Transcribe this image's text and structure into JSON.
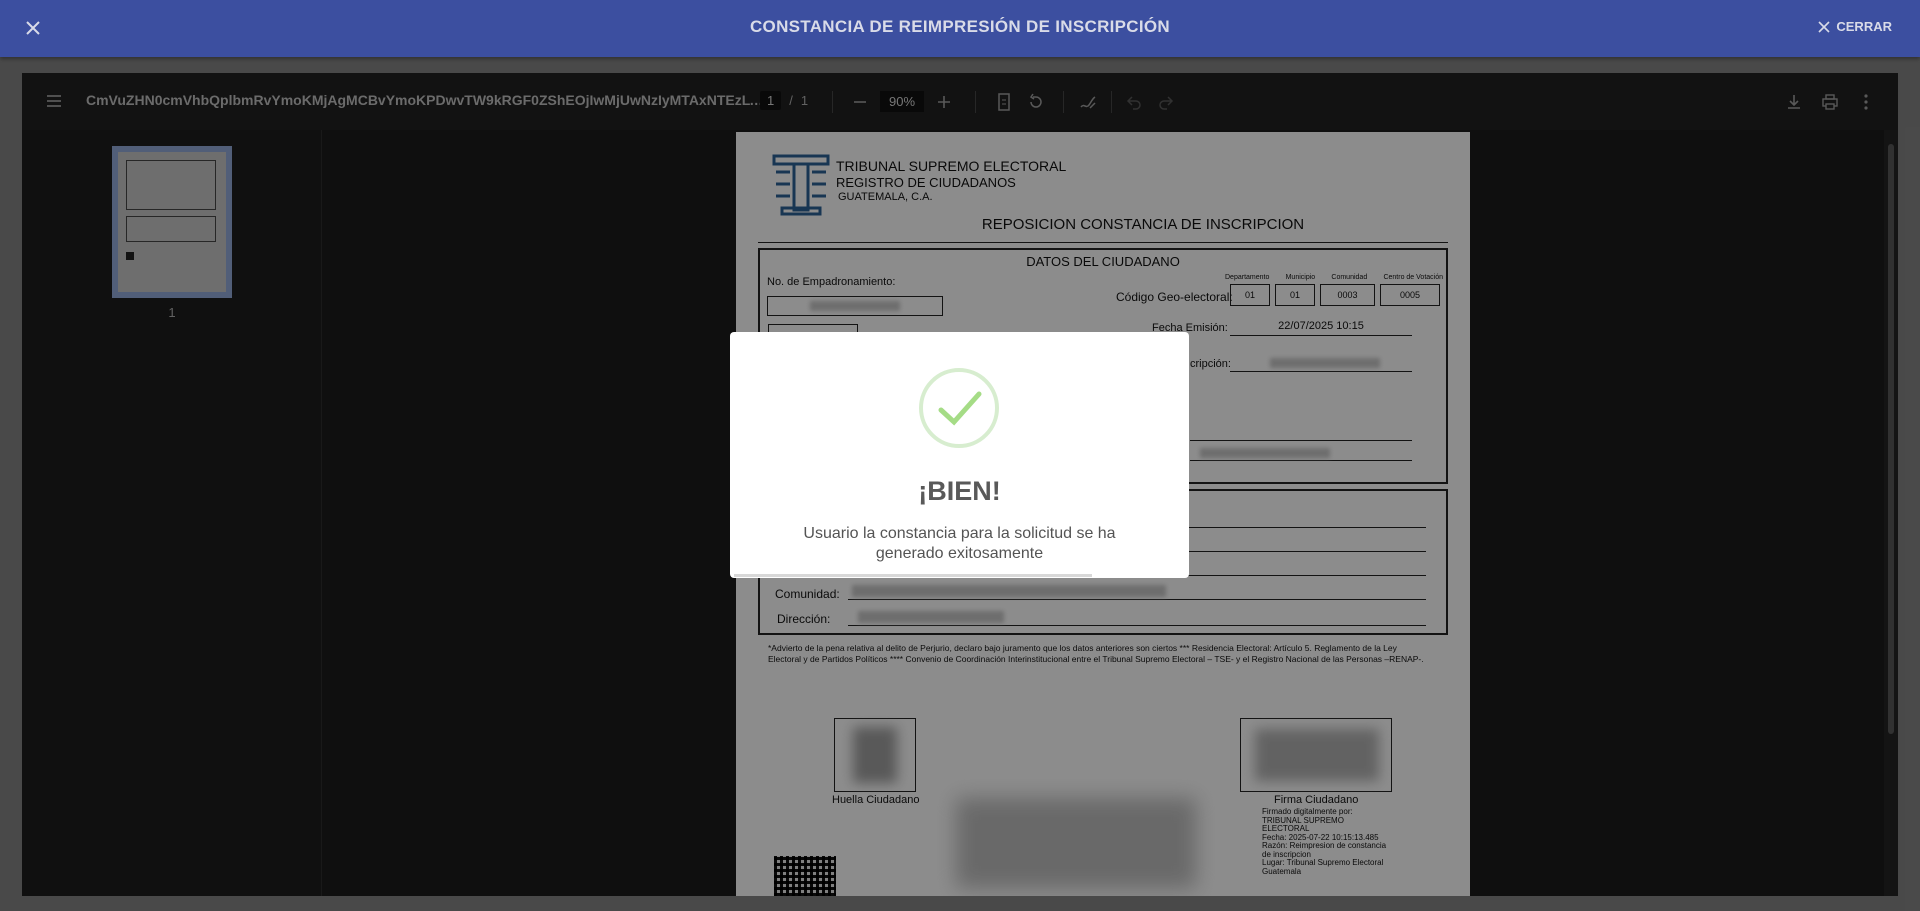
{
  "header": {
    "title": "CONSTANCIA DE REIMPRESIÓN DE INSCRIPCIÓN",
    "close_label": "CERRAR"
  },
  "viewer": {
    "file_name": "CmVuZHN0cmVhbQplbmRvYmoKMjAgMCBvYmoKPDwvTW9kRGF0ZShEOjIwMjUwNzIyMTAxNTEzLTA...",
    "page_current": "1",
    "page_sep": "/",
    "page_total": "1",
    "zoom": "90%",
    "thumb_label": "1"
  },
  "document": {
    "org_line1": "TRIBUNAL SUPREMO ELECTORAL",
    "org_line2": "REGISTRO DE CIUDADANOS",
    "org_line3": "GUATEMALA, C.A.",
    "doc_title": "REPOSICION CONSTANCIA DE INSCRIPCION",
    "section_title": "DATOS DEL CIUDADANO",
    "empadronamiento_label": "No. de Empadronamiento:",
    "geo_label": "Código Geo-electoral:",
    "geo_headers": [
      "Departamento",
      "Municipio",
      "Comunidad",
      "Centro de Votación"
    ],
    "geo_values": [
      "01",
      "01",
      "0003",
      "0005"
    ],
    "fecha_emision_label": "Fecha Emisión:",
    "fecha_emision_value": "22/07/2025 10:15",
    "inscripcion_label_partial": "cripción:",
    "comunidad_label": "Comunidad:",
    "direccion_label": "Dirección:",
    "footnote": "*Advierto de la pena relativa al delito de Perjurio, declaro bajo juramento que los datos anteriores son ciertos *** Residencia Electoral: Artículo 5. Reglamento de la Ley Electoral y de Partidos Políticos **** Convenio de Coordinación Interinstitucional entre el Tribunal Supremo Electoral – TSE- y el Registro Nacional de las Personas –RENAP-.",
    "huella_label": "Huella Ciudadano",
    "firma_label": "Firma Ciudadano",
    "signature_lines": [
      "Firmado digitalmente por:",
      "TRIBUNAL SUPREMO",
      "ELECTORAL",
      "Fecha: 2025-07-22 10:15:13.485",
      "Razón: Reimpresion de constancia",
      "de inscripcion",
      "Lugar: Tribunal Supremo Electoral",
      "Guatemala"
    ]
  },
  "modal": {
    "heading": "¡BIEN!",
    "message": "Usuario la constancia para la solicitud se ha generado exitosamente"
  },
  "colors": {
    "header_bg": "#3c4fa0",
    "success_green": "#a5dc86"
  }
}
